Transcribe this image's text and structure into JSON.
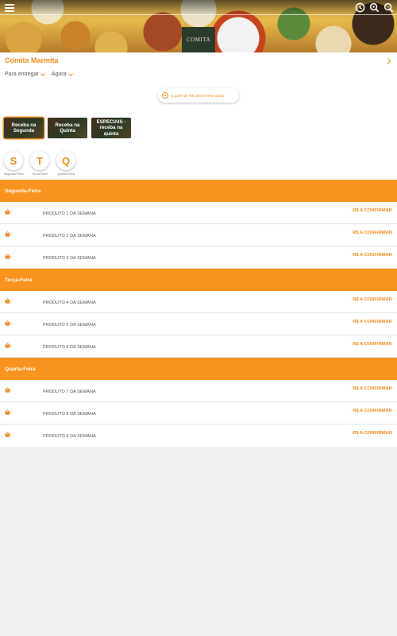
{
  "header": {
    "logo_text": "COMITA",
    "icons": [
      "menu-icon",
      "clock-icon",
      "search-icon",
      "magnifier-icon"
    ]
  },
  "store": {
    "name": "Comita Marmita",
    "delivery_mode": "Para entregar",
    "time": "Agora",
    "promo": "a partir de R$ 150,00 frete grátis"
  },
  "categories": [
    {
      "label": "Receba na Segunda"
    },
    {
      "label": "Receba na Quinta"
    },
    {
      "label": "ESPECIAIS - receba na quinta"
    }
  ],
  "days": [
    {
      "letter": "S",
      "label": "Segunda-Feira"
    },
    {
      "letter": "T",
      "label": "Terça-Feira"
    },
    {
      "letter": "Q",
      "label": "Quarta-Feira"
    }
  ],
  "sections": [
    {
      "title": "Segunda-Feira",
      "items": [
        {
          "name": "PRODUTO 1 DA SEMANA",
          "price": "R$ A CONFIRMAR"
        },
        {
          "name": "PRODUTO 2 DA SEMANA",
          "price": "R$ A CONFIRMAR"
        },
        {
          "name": "PRODUTO 3 DA SEMANA",
          "price": "R$ A CONFIRMAR"
        }
      ]
    },
    {
      "title": "Terça-Feira",
      "items": [
        {
          "name": "PRODUTO 4 DA SEMANA",
          "price": "R$ A CONFIRMAR"
        },
        {
          "name": "PRODUTO 5 DA SEMANA",
          "price": "R$ A CONFIRMAR"
        },
        {
          "name": "PRODUTO 6 DA SEMANA",
          "price": "R$ A CONFIRMAR"
        }
      ]
    },
    {
      "title": "Quarta-Feira",
      "items": [
        {
          "name": "PRODUTO 7 DA SEMANA",
          "price": "R$ A CONFIRMAR"
        },
        {
          "name": "PRODUTO 8 DA SEMANA",
          "price": "R$ A CONFIRMAR"
        },
        {
          "name": "PRODUTO 9 DA SEMANA",
          "price": "R$ A CONFIRMAR"
        }
      ]
    }
  ],
  "colors": {
    "accent": "#f7931e",
    "text_accent": "#f28c1e",
    "background": "#eef0f2"
  }
}
